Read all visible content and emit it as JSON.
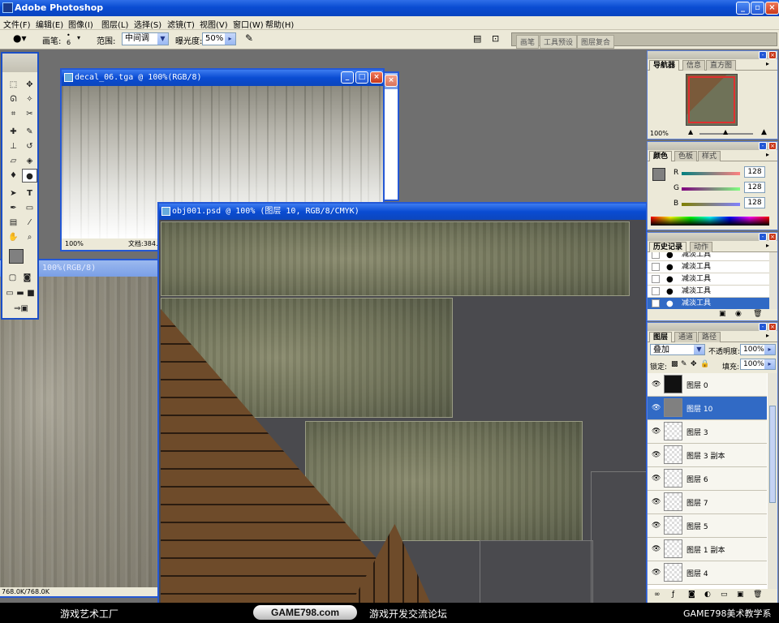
{
  "app": {
    "title": "Adobe Photoshop"
  },
  "menu": [
    "文件(F)",
    "编辑(E)",
    "图像(I)",
    "图层(L)",
    "选择(S)",
    "滤镜(T)",
    "视图(V)",
    "窗口(W)",
    "帮助(H)"
  ],
  "options": {
    "brush_label": "画笔:",
    "brush_size": "6",
    "range_label": "范围:",
    "range_value": "中间调",
    "exposure_label": "曝光度:",
    "exposure_value": "50%",
    "well_tabs": [
      "画笔",
      "工具预设",
      "图层复合"
    ]
  },
  "docs": {
    "decal": {
      "title": "decal_06.tga @ 100%(RGB/8)",
      "zoom": "100%",
      "info": "文档:384."
    },
    "bg": {
      "title": "100%(RGB/8)",
      "zoom": "768.0K/768.0K"
    },
    "obj": {
      "title": "obj001.psd @ 100% (图层 10, RGB/8/CMYK)"
    }
  },
  "navigator": {
    "tabs": [
      "导航器",
      "信息",
      "直方图"
    ],
    "zoom": "100%"
  },
  "color": {
    "tabs": [
      "颜色",
      "色板",
      "样式"
    ],
    "channels": [
      {
        "name": "R",
        "value": "128"
      },
      {
        "name": "G",
        "value": "128"
      },
      {
        "name": "B",
        "value": "128"
      }
    ]
  },
  "history": {
    "tabs": [
      "历史记录",
      "动作"
    ],
    "items": [
      "减淡工具",
      "减淡工具",
      "减淡工具",
      "减淡工具",
      "减淡工具"
    ]
  },
  "layers": {
    "tabs": [
      "图层",
      "通道",
      "路径"
    ],
    "blend_mode": "叠加",
    "opacity_label": "不透明度:",
    "opacity": "100%",
    "lock_label": "锁定:",
    "fill_label": "填充:",
    "fill": "100%",
    "items": [
      "图层 0",
      "图层 10",
      "图层 3",
      "图层 3 副本",
      "图层 6",
      "图层 7",
      "图层 5",
      "图层 1 副本",
      "图层 4"
    ],
    "selected_index": 1
  },
  "banner": {
    "left": "游戏艺术工厂",
    "badge": "GAME798.com",
    "center": "游戏开发交流论坛",
    "right": "GAME798美术教学系"
  },
  "colors": {
    "xp_blue": "#0a4cd2",
    "panel_bg": "#ece9d8",
    "selection": "#316ac5",
    "workspace": "#6f6f6f"
  }
}
